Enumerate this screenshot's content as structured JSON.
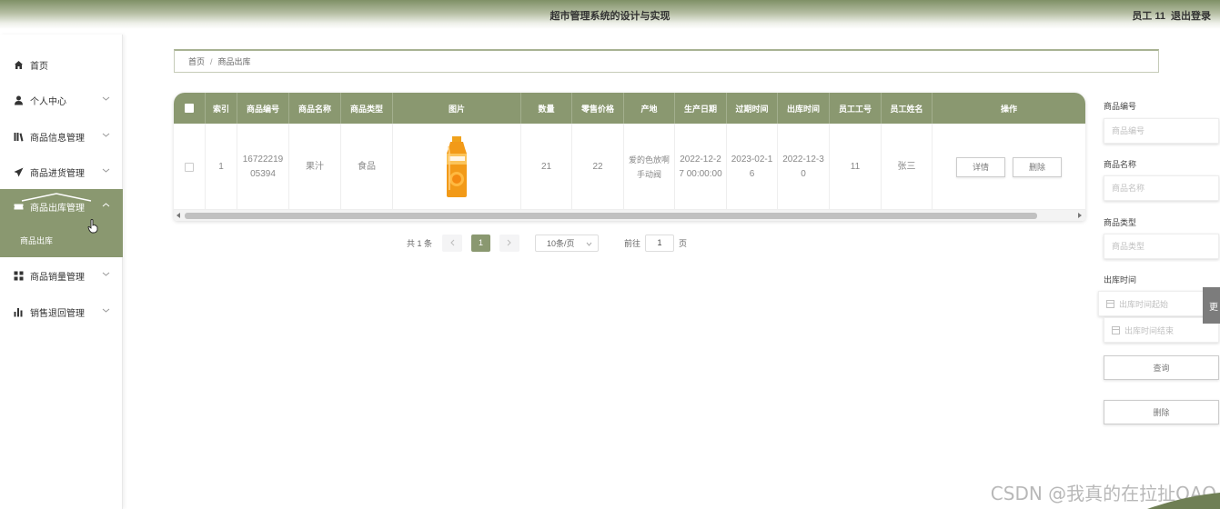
{
  "header": {
    "title": "超市管理系统的设计与实现",
    "user": "员工 11",
    "logout": "退出登录"
  },
  "sidebar": {
    "items": [
      {
        "label": "首页",
        "icon": "home-icon"
      },
      {
        "label": "个人中心",
        "icon": "person-icon"
      },
      {
        "label": "商品信息管理",
        "icon": "library-icon"
      },
      {
        "label": "商品进货管理",
        "icon": "send-icon"
      },
      {
        "label": "商品出库管理",
        "icon": "ticket-icon"
      },
      {
        "label": "商品销量管理",
        "icon": "grid-icon"
      },
      {
        "label": "销售退回管理",
        "icon": "bar-chart-icon"
      }
    ],
    "submenu_label": "商品出库"
  },
  "breadcrumb": {
    "home": "首页",
    "separator": "/",
    "current": "商品出库"
  },
  "table": {
    "columns": [
      "索引",
      "商品编号",
      "商品名称",
      "商品类型",
      "图片",
      "数量",
      "零售价格",
      "产地",
      "生产日期",
      "过期时间",
      "出库时间",
      "员工工号",
      "员工姓名",
      "操作"
    ],
    "rows": [
      {
        "index": "1",
        "code": "1672221905394",
        "name": "果汁",
        "type": "食品",
        "image": "orange-juice-bottle",
        "qty": "21",
        "price": "22",
        "origin": "爱的色放啊手动阀",
        "prod_date": "2022-12-27 00:00:00",
        "expire": "2023-02-16",
        "out_date": "2022-12-30",
        "emp_no": "11",
        "emp_name": "张三",
        "detail": "详情",
        "delete": "删除"
      }
    ]
  },
  "pagination": {
    "total": "共 1 条",
    "current_page": "1",
    "page_size": "10条/页",
    "goto": "前往",
    "goto_value": "1",
    "page_unit": "页"
  },
  "search": {
    "code_label": "商品编号",
    "code_placeholder": "商品编号",
    "name_label": "商品名称",
    "name_placeholder": "商品名称",
    "type_label": "商品类型",
    "type_placeholder": "商品类型",
    "time_label": "出库时间",
    "time_start": "出库时间起始",
    "time_end": "出库时间结束",
    "query_button": "查询",
    "delete_button": "删除"
  },
  "side_tab": "更",
  "watermark": "CSDN @我真的在拉扯QAQ",
  "colors": {
    "accent": "#8a9870",
    "header_dark": "#7f9066"
  }
}
